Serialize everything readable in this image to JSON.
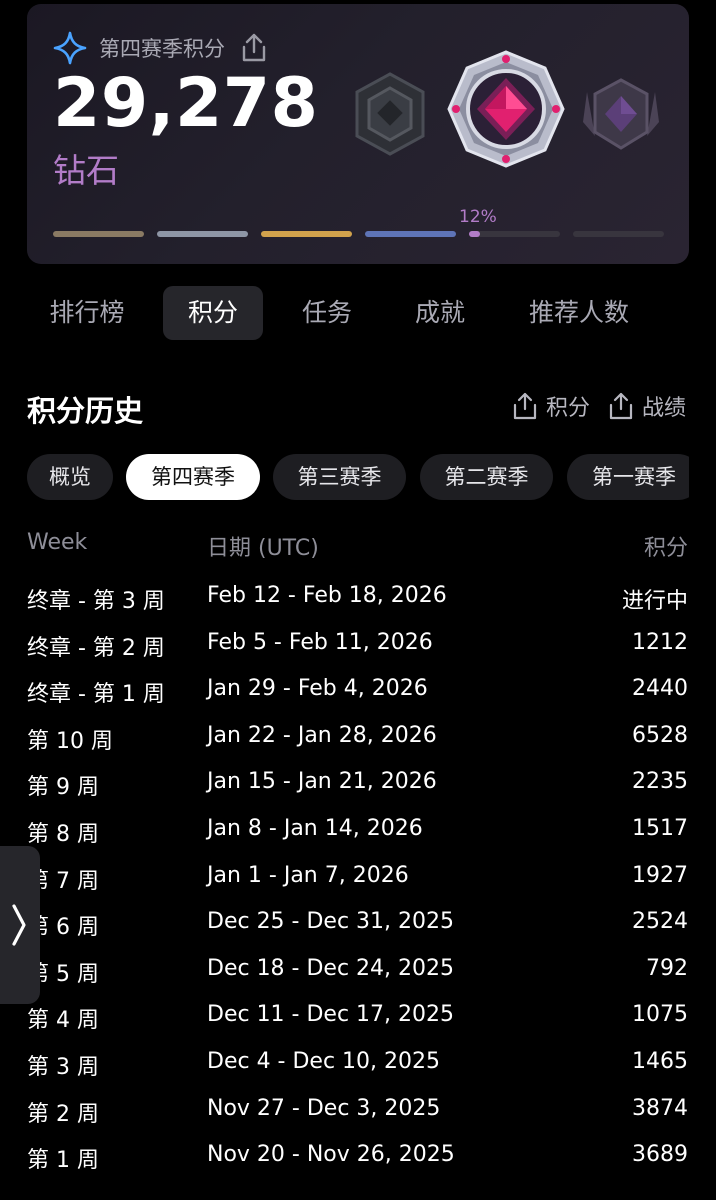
{
  "season_card": {
    "label": "第四赛季积分",
    "score": "29,278",
    "rank": "钻石",
    "progress_label": "12%",
    "progress": 0.12,
    "icons": [
      "sparkle-star-icon",
      "share-icon",
      "gem-badge-icon"
    ],
    "tiers": [
      {
        "color": "#8a7a63",
        "fill": 1
      },
      {
        "color": "#8e96a6",
        "fill": 1
      },
      {
        "color": "#d1a24c",
        "fill": 1
      },
      {
        "color": "#5e74b7",
        "fill": 1
      },
      {
        "color": "#38353e",
        "fill": 0.12
      },
      {
        "color": "#38353e",
        "fill": 0
      }
    ]
  },
  "tabs": [
    "排行榜",
    "积分",
    "任务",
    "成就",
    "推荐人数"
  ],
  "active_tab": 1,
  "history": {
    "title": "积分历史",
    "export_points": "积分",
    "export_record": "战绩"
  },
  "seasons": [
    "概览",
    "第四赛季",
    "第三赛季",
    "第二赛季",
    "第一赛季"
  ],
  "active_season": 1,
  "table": {
    "headers": {
      "week": "Week",
      "date": "日期 (UTC)",
      "points": "积分"
    },
    "rows": [
      {
        "week": "终章 - 第 3 周",
        "date": "Feb 12 - Feb 18, 2026",
        "points": "进行中"
      },
      {
        "week": "终章 - 第 2 周",
        "date": "Feb 5 - Feb 11, 2026",
        "points": "1212"
      },
      {
        "week": "终章 - 第 1 周",
        "date": "Jan 29 - Feb 4, 2026",
        "points": "2440"
      },
      {
        "week": "第 10 周",
        "date": "Jan 22 - Jan 28, 2026",
        "points": "6528"
      },
      {
        "week": "第 9 周",
        "date": "Jan 15 - Jan 21, 2026",
        "points": "2235"
      },
      {
        "week": "第 8 周",
        "date": "Jan 8 - Jan 14, 2026",
        "points": "1517"
      },
      {
        "week": "第 7 周",
        "date": "Jan 1 - Jan 7, 2026",
        "points": "1927"
      },
      {
        "week": "第 6 周",
        "date": "Dec 25 - Dec 31, 2025",
        "points": "2524"
      },
      {
        "week": "第 5 周",
        "date": "Dec 18 - Dec 24, 2025",
        "points": "792"
      },
      {
        "week": "第 4 周",
        "date": "Dec 11 - Dec 17, 2025",
        "points": "1075"
      },
      {
        "week": "第 3 周",
        "date": "Dec 4 - Dec 10, 2025",
        "points": "1465"
      },
      {
        "week": "第 2 周",
        "date": "Nov 27 - Dec 3, 2025",
        "points": "3874"
      },
      {
        "week": "第 1 周",
        "date": "Nov 20 - Nov 26, 2025",
        "points": "3689"
      }
    ]
  },
  "side_handle_icon": "chevron-right-icon"
}
